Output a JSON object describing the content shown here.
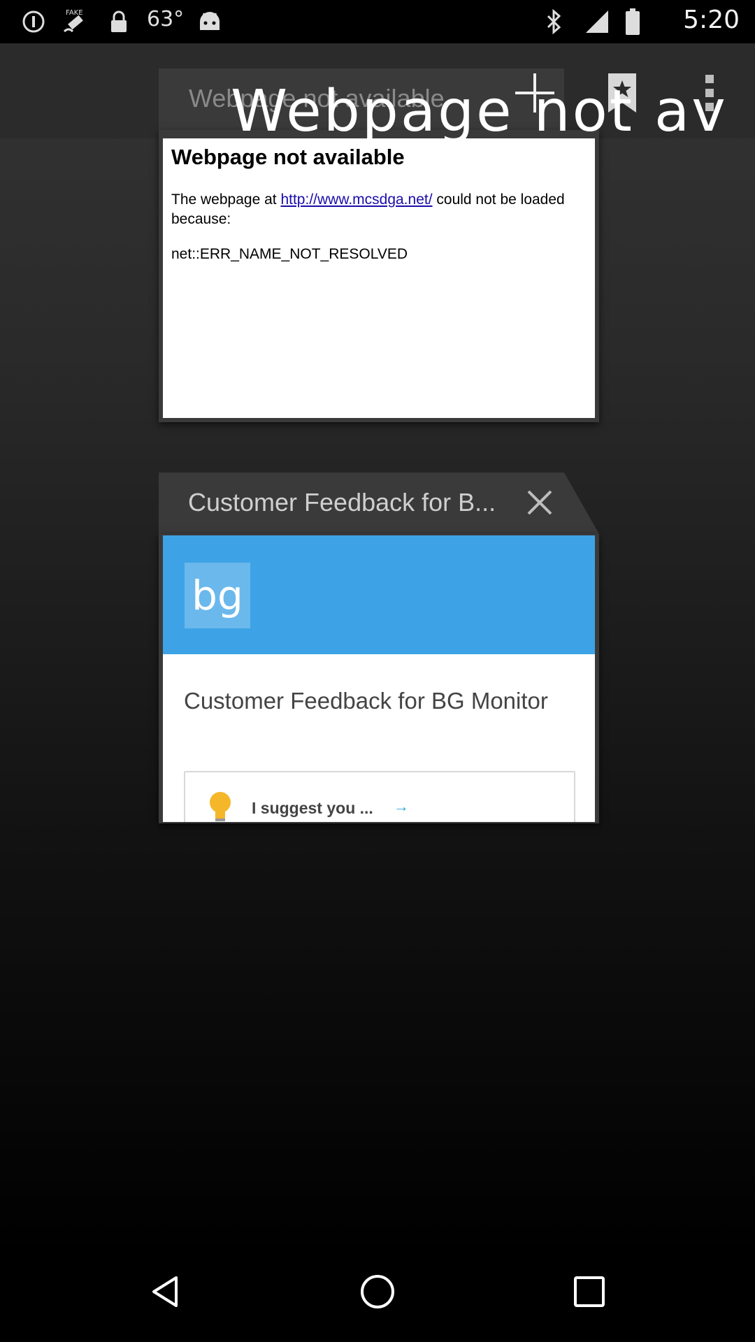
{
  "status_bar": {
    "temperature": "63°",
    "time": "5:20",
    "icons": [
      "alert-icon",
      "fake-gps-icon",
      "lock-icon",
      "android-icon",
      "bluetooth-icon",
      "signal-icon",
      "battery-icon"
    ]
  },
  "action_bar": {
    "title": "Webpage not av",
    "icons": [
      "plus-icon",
      "bookmark-icon",
      "overflow-menu-icon"
    ]
  },
  "tab1": {
    "title": "Webpage not available",
    "content": {
      "heading": "Webpage not available",
      "text_before_link": "The webpage at ",
      "link": "http://www.mcsdga.net/",
      "text_after_link": " could not be loaded because:",
      "error_code": "net::ERR_NAME_NOT_RESOLVED"
    }
  },
  "tab2": {
    "title": "Customer Feedback for B...",
    "content": {
      "logo_text": "bg",
      "heading": "Customer Feedback for BG Monitor",
      "suggest_label": "I suggest you ...",
      "suggest_arrow": "→"
    },
    "banner_color": "#3ea3e6"
  },
  "nav_bar": {
    "icons": [
      "back-icon",
      "home-icon",
      "recent-apps-icon"
    ]
  }
}
